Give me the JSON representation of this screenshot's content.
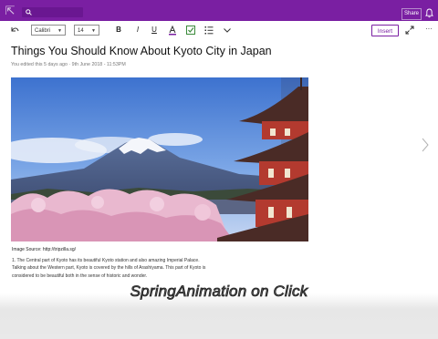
{
  "header": {
    "back_glyph": "⇱",
    "search_icon": "search-icon",
    "share_label": "Share",
    "bell_icon": "bell-icon",
    "accent_color": "#7a1fa2"
  },
  "toolbar": {
    "undo_icon": "undo-icon",
    "font_name": "Calibri",
    "font_size": "14",
    "bold_label": "B",
    "italic_label": "I",
    "underline_label": "U",
    "font_color_icon": "font-color-icon",
    "checkbox_icon": "todo-checkbox-icon",
    "list_icon": "bullet-list-icon",
    "expand_icon": "chevron-down-icon",
    "insert_label": "Insert",
    "fullscreen_icon": "expand-icon",
    "more_label": "···"
  },
  "page": {
    "title": "Things You Should Know About Kyoto City in Japan",
    "meta": "You edited this 5 days ago · 9th June 2018 - 11:53PM",
    "image_source": "Image Source: http://tripzilla.sg/",
    "paragraph_lines": [
      "1. The Central part of Kyoto has its beautiful Kyoto station and also amazing Imperial Palace.",
      "Talking about the Western part, Kyoto is covered by the hills of Arashiyama. This part of Kyoto is",
      "considered to be beautiful both in the sense of historic and wonder."
    ],
    "next_icon": "chevron-right-icon"
  },
  "overlay": {
    "caption": "SpringAnimation on Click"
  }
}
